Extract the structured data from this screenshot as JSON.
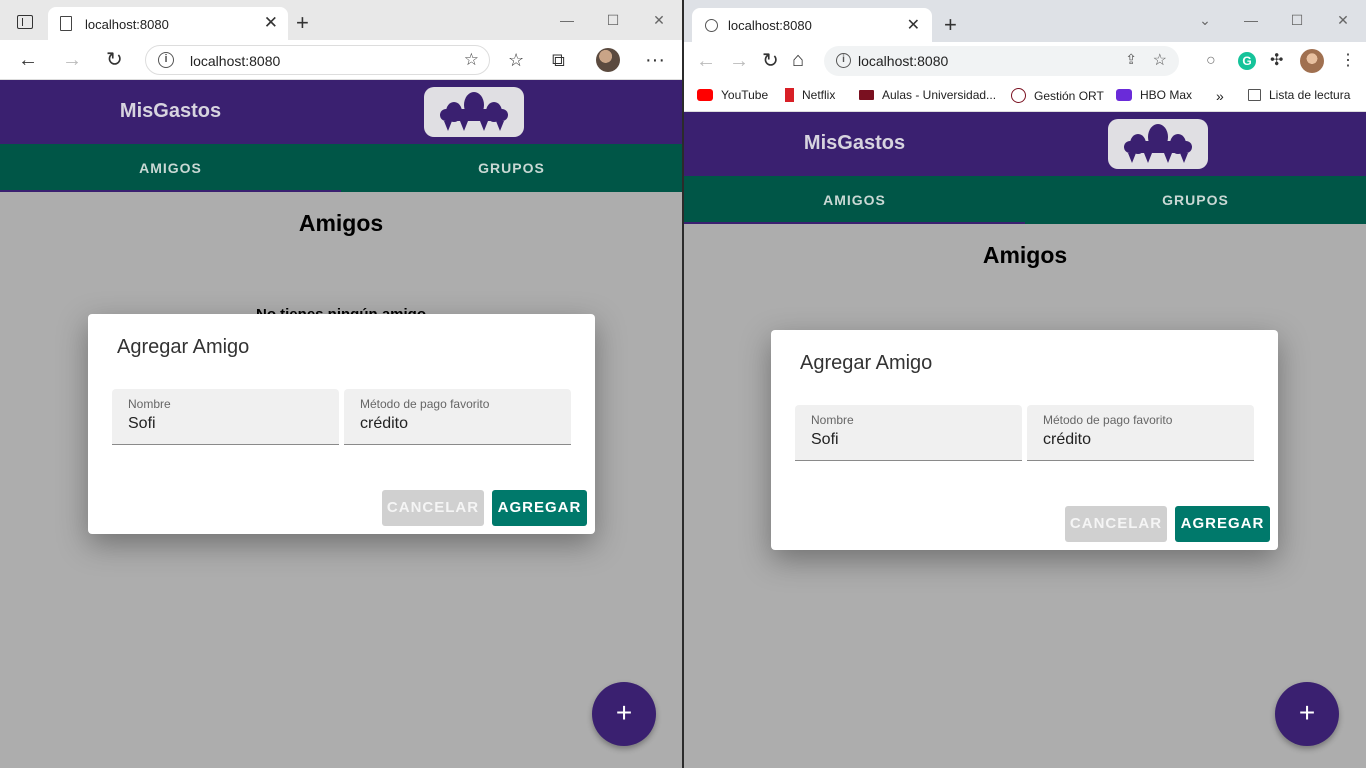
{
  "left_browser": {
    "tab_title": "localhost:8080",
    "url": "localhost:8080"
  },
  "right_browser": {
    "tab_title": "localhost:8080",
    "url": "localhost:8080",
    "bookmarks": [
      "YouTube",
      "Netflix",
      "Aulas - Universidad...",
      "Gestión ORT",
      "HBO Max"
    ],
    "reading_list": "Lista de lectura"
  },
  "app": {
    "brand": "MisGastos",
    "tabs": [
      "AMIGOS",
      "GRUPOS"
    ],
    "page_title": "Amigos",
    "empty_message": "No tienes ningún amigo",
    "fab_label": "+"
  },
  "dialog": {
    "title": "Agregar Amigo",
    "name_label": "Nombre",
    "name_value": "Sofi",
    "payment_label": "Método de pago favorito",
    "payment_value": "crédito",
    "cancel_label": "CANCELAR",
    "add_label": "AGREGAR"
  },
  "colors": {
    "header": "#3a2070",
    "tabs": "#005647",
    "primary_button": "#00796b",
    "overlay": "#adadad"
  }
}
